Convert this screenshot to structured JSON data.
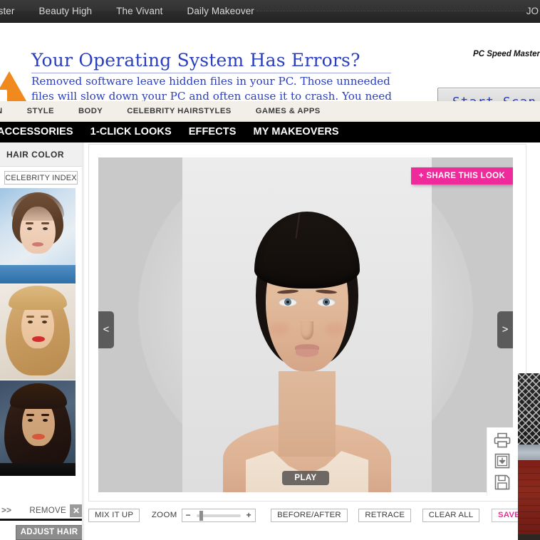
{
  "partner_bar": {
    "links": [
      "aster",
      "Beauty High",
      "The Vivant",
      "Daily Makeover"
    ],
    "right_label": "JO"
  },
  "ad": {
    "headline": "Your Operating System Has Errors?",
    "body": "Removed software leave hidden files in your PC. Those unneeded files will slow down your PC and often cause it to crash. You need to Clean Your Registry Now!",
    "brand": "PC Speed Master",
    "cta_label": "Start Scan",
    "warning_icon": "warning-triangle-icon",
    "link_color": "#2b3fbd",
    "warning_color": "#f08a1e"
  },
  "site_nav": {
    "items": [
      "N",
      "STYLE",
      "BODY",
      "CELEBRITY HAIRSTYLES",
      "GAMES & APPS"
    ]
  },
  "tool_nav": {
    "items": [
      "ACCESSORIES",
      "1-CLICK LOOKS",
      "EFFECTS",
      "MY MAKEOVERS"
    ]
  },
  "sidebar": {
    "header": "HAIR COLOR",
    "celebrity_index_label": "CELEBRITY INDEX",
    "thumbnails": [
      {
        "name": "celebrity-thumb-1",
        "alt": "short brown pixie haircut celebrity headshot"
      },
      {
        "name": "celebrity-thumb-2",
        "alt": "long blonde hair celebrity headshot"
      },
      {
        "name": "celebrity-thumb-3",
        "alt": "long dark brunette hair celebrity headshot"
      }
    ],
    "prev_arrows": ">>",
    "remove_label": "REMOVE",
    "remove_icon": "close-x-icon",
    "adjust_hair_label": "ADJUST HAIR"
  },
  "canvas": {
    "share_label": "+ SHARE THIS LOOK",
    "share_color": "#ef2a9a",
    "prev_arrow": "<",
    "next_arrow": ">",
    "play_label": "PLAY",
    "stage_bg": "#c9c9c9",
    "icons": [
      {
        "name": "print-icon",
        "label": "Print"
      },
      {
        "name": "download-icon",
        "label": "Download"
      },
      {
        "name": "floppy-save-icon",
        "label": "Save"
      }
    ]
  },
  "toolbar": {
    "mix_it_up_label": "MIX IT UP",
    "zoom_label": "ZOOM",
    "zoom_minus": "−",
    "zoom_plus": "+",
    "zoom_value": "8",
    "before_after_label": "BEFORE/AFTER",
    "retrace_label": "RETRACE",
    "clear_all_label": "CLEAR ALL",
    "save_label": "SAVE",
    "save_color": "#ef2a9a"
  },
  "right_sliver": {
    "name": "partial-ad-image",
    "alt": "chain link fence over red brick wall"
  }
}
